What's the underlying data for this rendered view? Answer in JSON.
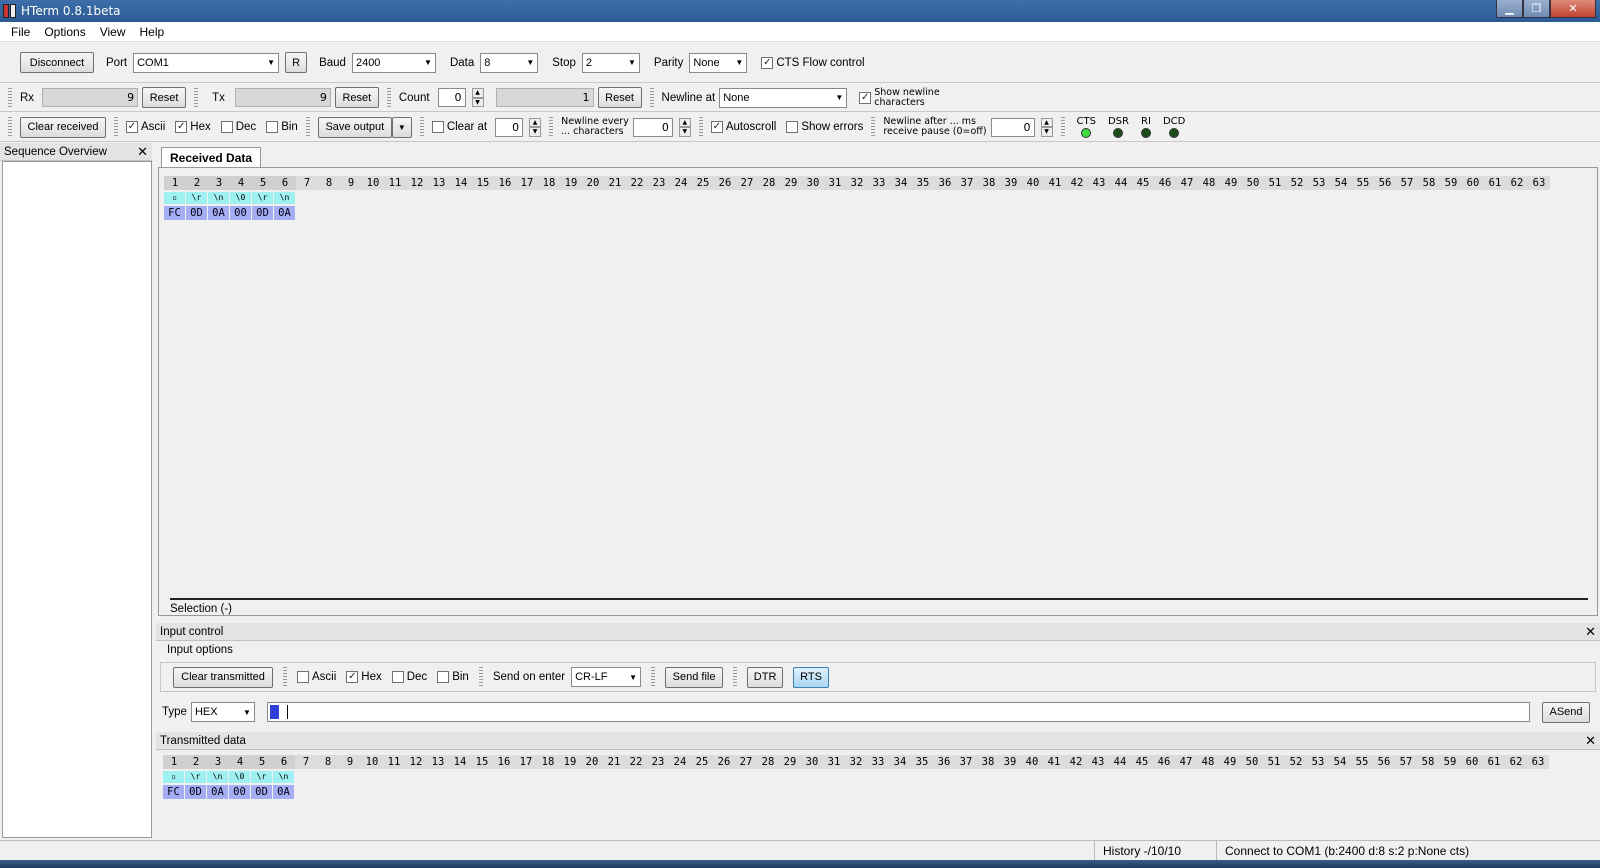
{
  "window": {
    "title": "HTerm 0.8.1beta"
  },
  "menu": [
    "File",
    "Options",
    "View",
    "Help"
  ],
  "connection": {
    "disconnect_label": "Disconnect",
    "port_label": "Port",
    "port_value": "COM1",
    "refresh_label": "R",
    "baud_label": "Baud",
    "baud_value": "2400",
    "data_label": "Data",
    "data_value": "8",
    "stop_label": "Stop",
    "stop_value": "2",
    "parity_label": "Parity",
    "parity_value": "None",
    "cts_flow_label": "CTS Flow control",
    "cts_flow_checked": true
  },
  "counters": {
    "rx_label": "Rx",
    "rx_value": "9",
    "rx_reset": "Reset",
    "tx_label": "Tx",
    "tx_value": "9",
    "tx_reset": "Reset",
    "count_label": "Count",
    "count_value": "0",
    "count_field": "1",
    "count_reset": "Reset",
    "newline_label": "Newline at",
    "newline_value": "None",
    "show_newline_line1": "Show newline",
    "show_newline_line2": "characters",
    "show_newline_checked": true
  },
  "received_toolbar": {
    "clear_label": "Clear received",
    "ascii": "Ascii",
    "hex": "Hex",
    "dec": "Dec",
    "bin": "Bin",
    "save_label": "Save output",
    "clear_at_label": "Clear at",
    "clear_at_value": "0",
    "newline_every_line1": "Newline every",
    "newline_every_line2": "... characters",
    "newline_every_value": "0",
    "autoscroll_label": "Autoscroll",
    "show_errors_label": "Show errors",
    "newline_after_line1": "Newline after ... ms",
    "newline_after_line2": "receive pause (0=off)",
    "newline_after_value": "0",
    "leds": [
      "CTS",
      "DSR",
      "RI",
      "DCD"
    ]
  },
  "sequence_overview": {
    "title": "Sequence Overview"
  },
  "received": {
    "tab_label": "Received Data",
    "ascii": [
      "\u0000",
      "\\r",
      "\\n",
      "\\0",
      "\\r",
      "\\n"
    ],
    "hex": [
      "FC",
      "0D",
      "0A",
      "00",
      "0D",
      "0A"
    ],
    "selection_label": "Selection (-)"
  },
  "input_control": {
    "title": "Input control",
    "options_label": "Input options",
    "clear_label": "Clear transmitted",
    "ascii": "Ascii",
    "hex": "Hex",
    "dec": "Dec",
    "bin": "Bin",
    "send_on_enter_label": "Send on enter",
    "send_on_enter_value": "CR-LF",
    "send_file_label": "Send file",
    "dtr_label": "DTR",
    "rts_label": "RTS",
    "type_label": "Type",
    "type_value": "HEX",
    "asend_label": "ASend"
  },
  "transmitted": {
    "title": "Transmitted data",
    "ascii": [
      "\u0000",
      "\\r",
      "\\n",
      "\\0",
      "\\r",
      "\\n"
    ],
    "hex": [
      "FC",
      "0D",
      "0A",
      "00",
      "0D",
      "0A"
    ]
  },
  "status": {
    "history": "History -/10/10",
    "connection": "Connect to COM1 (b:2400 d:8 s:2 p:None cts)"
  }
}
